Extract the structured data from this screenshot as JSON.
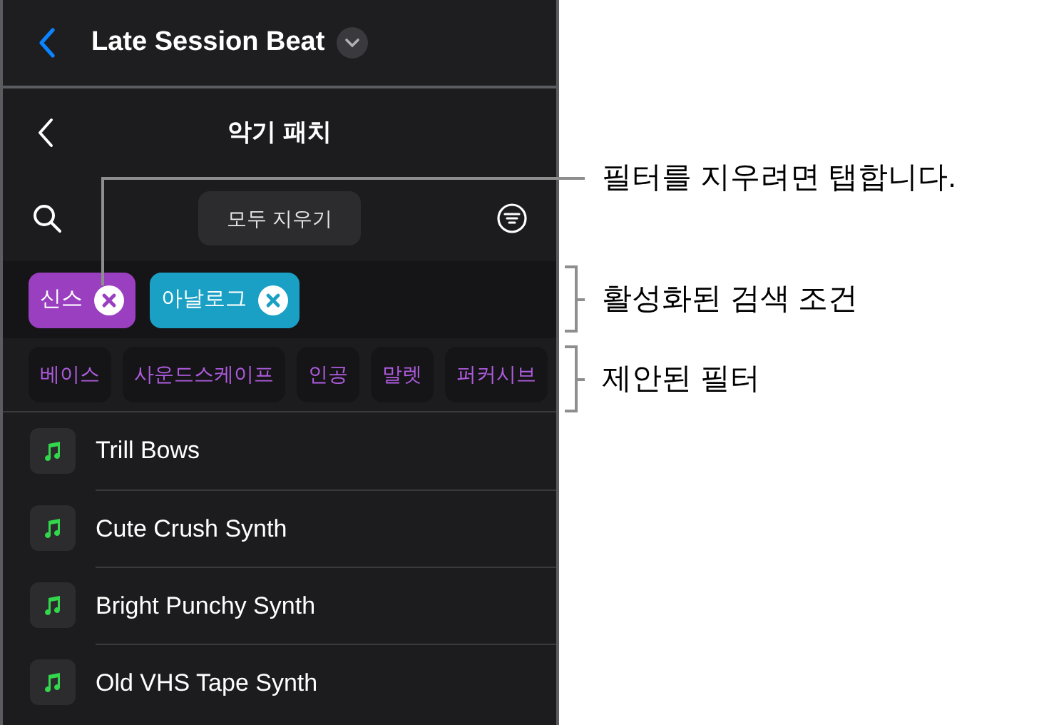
{
  "top_bar": {
    "title": "Late Session Beat"
  },
  "panel": {
    "title": "악기 패치",
    "clear_all": "모두 지우기"
  },
  "active_filters": [
    {
      "label": "신스",
      "color": "#9a3fbf"
    },
    {
      "label": "아날로그",
      "color": "#1aa0c4"
    }
  ],
  "suggested_filters": [
    "베이스",
    "사운드스케이프",
    "인공",
    "말렛",
    "퍼커시브"
  ],
  "patches": [
    "Trill Bows",
    "Cute Crush Synth",
    "Bright Punchy Synth",
    "Old VHS Tape Synth"
  ],
  "callouts": [
    {
      "kind": "line",
      "text": "필터를 지우려면 탭합니다."
    },
    {
      "kind": "bracket",
      "text": "활성화된 검색 조건"
    },
    {
      "kind": "bracket",
      "text": "제안된 필터"
    }
  ]
}
